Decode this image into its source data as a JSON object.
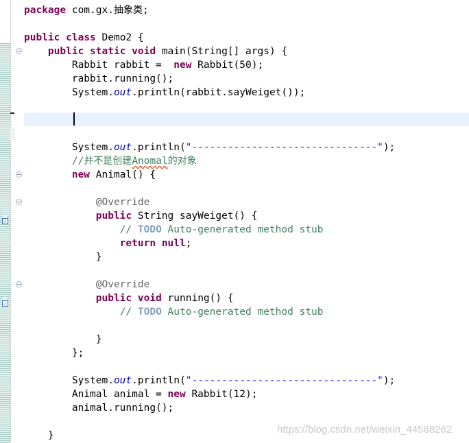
{
  "editor": {
    "lines": [
      {
        "id": "l1",
        "segments": [
          {
            "t": "kw",
            "v": "package"
          },
          {
            "t": "plain",
            "v": " com.gx."
          },
          {
            "t": "cn",
            "v": "抽象类"
          },
          {
            "t": "plain",
            "v": ";"
          }
        ]
      },
      {
        "id": "l2",
        "segments": []
      },
      {
        "id": "l3",
        "segments": [
          {
            "t": "kw",
            "v": "public"
          },
          {
            "t": "plain",
            "v": " "
          },
          {
            "t": "kw",
            "v": "class"
          },
          {
            "t": "plain",
            "v": " Demo2 {"
          }
        ]
      },
      {
        "id": "l4",
        "segments": [
          {
            "t": "plain",
            "v": "    "
          },
          {
            "t": "kw",
            "v": "public"
          },
          {
            "t": "plain",
            "v": " "
          },
          {
            "t": "kw",
            "v": "static"
          },
          {
            "t": "plain",
            "v": " "
          },
          {
            "t": "kw",
            "v": "void"
          },
          {
            "t": "plain",
            "v": " main(String[] args) {"
          }
        ]
      },
      {
        "id": "l5",
        "segments": [
          {
            "t": "plain",
            "v": "        Rabbit rabbit =  "
          },
          {
            "t": "kw",
            "v": "new"
          },
          {
            "t": "plain",
            "v": " Rabbit(50);"
          }
        ]
      },
      {
        "id": "l6",
        "segments": [
          {
            "t": "plain",
            "v": "        rabbit.running();"
          }
        ]
      },
      {
        "id": "l7",
        "segments": [
          {
            "t": "plain",
            "v": "        System."
          },
          {
            "t": "fld",
            "v": "out"
          },
          {
            "t": "plain",
            "v": ".println(rabbit.sayWeiget());"
          }
        ]
      },
      {
        "id": "l8",
        "segments": []
      },
      {
        "id": "l9",
        "segments": []
      },
      {
        "id": "l10",
        "segments": []
      },
      {
        "id": "l11",
        "segments": [
          {
            "t": "plain",
            "v": "        System."
          },
          {
            "t": "fld",
            "v": "out"
          },
          {
            "t": "plain",
            "v": ".println("
          },
          {
            "t": "str",
            "v": "\"-------------------------------\""
          },
          {
            "t": "plain",
            "v": ");"
          }
        ]
      },
      {
        "id": "l12",
        "segments": [
          {
            "t": "plain",
            "v": "        "
          },
          {
            "t": "cmt",
            "v": "//"
          },
          {
            "t": "cmtcn",
            "v": "并不是创建"
          },
          {
            "t": "cmtsq",
            "v": "Anomal"
          },
          {
            "t": "cmtcn",
            "v": "的对象"
          }
        ]
      },
      {
        "id": "l13",
        "segments": [
          {
            "t": "plain",
            "v": "        "
          },
          {
            "t": "kw",
            "v": "new"
          },
          {
            "t": "plain",
            "v": " Animal() {"
          }
        ]
      },
      {
        "id": "l14",
        "segments": []
      },
      {
        "id": "l15",
        "segments": [
          {
            "t": "plain",
            "v": "            "
          },
          {
            "t": "ann",
            "v": "@Override"
          }
        ]
      },
      {
        "id": "l16",
        "segments": [
          {
            "t": "plain",
            "v": "            "
          },
          {
            "t": "kw",
            "v": "public"
          },
          {
            "t": "plain",
            "v": " String sayWeiget() {"
          }
        ]
      },
      {
        "id": "l17",
        "segments": [
          {
            "t": "plain",
            "v": "                "
          },
          {
            "t": "cmt",
            "v": "// "
          },
          {
            "t": "todo",
            "v": "TODO"
          },
          {
            "t": "cmt",
            "v": " Auto-generated method stub"
          }
        ]
      },
      {
        "id": "l18",
        "segments": [
          {
            "t": "plain",
            "v": "                "
          },
          {
            "t": "kw",
            "v": "return"
          },
          {
            "t": "plain",
            "v": " "
          },
          {
            "t": "kw",
            "v": "null"
          },
          {
            "t": "plain",
            "v": ";"
          }
        ]
      },
      {
        "id": "l19",
        "segments": [
          {
            "t": "plain",
            "v": "            }"
          }
        ]
      },
      {
        "id": "l20",
        "segments": []
      },
      {
        "id": "l21",
        "segments": [
          {
            "t": "plain",
            "v": "            "
          },
          {
            "t": "ann",
            "v": "@Override"
          }
        ]
      },
      {
        "id": "l22",
        "segments": [
          {
            "t": "plain",
            "v": "            "
          },
          {
            "t": "kw",
            "v": "public"
          },
          {
            "t": "plain",
            "v": " "
          },
          {
            "t": "kw",
            "v": "void"
          },
          {
            "t": "plain",
            "v": " running() {"
          }
        ]
      },
      {
        "id": "l23",
        "segments": [
          {
            "t": "plain",
            "v": "                "
          },
          {
            "t": "cmt",
            "v": "// "
          },
          {
            "t": "todo",
            "v": "TODO"
          },
          {
            "t": "cmt",
            "v": " Auto-generated method stub"
          }
        ]
      },
      {
        "id": "l24",
        "segments": []
      },
      {
        "id": "l25",
        "segments": [
          {
            "t": "plain",
            "v": "            }"
          }
        ]
      },
      {
        "id": "l26",
        "segments": [
          {
            "t": "plain",
            "v": "        };"
          }
        ]
      },
      {
        "id": "l27",
        "segments": []
      },
      {
        "id": "l28",
        "segments": [
          {
            "t": "plain",
            "v": "        System."
          },
          {
            "t": "fld",
            "v": "out"
          },
          {
            "t": "plain",
            "v": ".println("
          },
          {
            "t": "str",
            "v": "\"-------------------------------\""
          },
          {
            "t": "plain",
            "v": ");"
          }
        ]
      },
      {
        "id": "l29",
        "segments": [
          {
            "t": "plain",
            "v": "        Animal animal = "
          },
          {
            "t": "kw",
            "v": "new"
          },
          {
            "t": "plain",
            "v": " Rabbit(12);"
          }
        ]
      },
      {
        "id": "l30",
        "segments": [
          {
            "t": "plain",
            "v": "        animal.running();"
          }
        ]
      },
      {
        "id": "l31",
        "segments": []
      },
      {
        "id": "l32",
        "segments": [
          {
            "t": "plain",
            "v": "    }"
          }
        ]
      }
    ],
    "fold_icons": [
      "fold-toggle-icon",
      "fold-toggle-icon",
      "fold-toggle-icon",
      "fold-toggle-icon"
    ],
    "override_markers": [
      "override-marker-icon",
      "override-marker-icon"
    ]
  },
  "colors": {
    "keyword": "#7f0055",
    "field": "#0000c0",
    "string": "#2a00ff",
    "comment": "#3f7f5f",
    "todo": "#7f9fbf",
    "annotation": "#646464",
    "current_line": "#e8f2fe"
  },
  "watermark": "https://blog.csdn.net/weixin_44588262"
}
